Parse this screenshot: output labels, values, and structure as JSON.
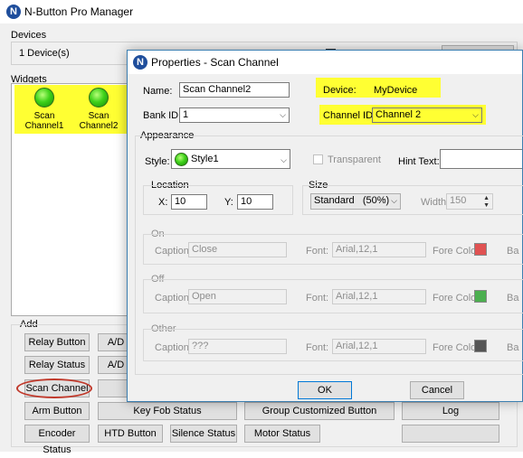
{
  "app": {
    "title": "N-Button Pro Manager",
    "logo_letter": "N"
  },
  "devices": {
    "header": "Devices",
    "count_text": "1 Device(s)"
  },
  "widgets": {
    "header": "Widgets",
    "items": [
      {
        "label": "Scan Channel1"
      },
      {
        "label": "Scan Channel2"
      }
    ]
  },
  "add": {
    "header": "Add",
    "buttons": {
      "relay_button": "Relay Button",
      "relay_status": "Relay Status",
      "scan_channel": "Scan Channel",
      "arm_button": "Arm Button",
      "encoder_status": "Encoder Status",
      "ad1": "A/D",
      "ad2": "A/D",
      "key_fob_status": "Key Fob Status",
      "htd_button": "HTD Button",
      "silence_status": "Silence Status",
      "group_customized_button": "Group Customized Button",
      "motor_status": "Motor Status",
      "log": "Log"
    }
  },
  "dialog": {
    "title": "Properties - Scan Channel",
    "logo_letter": "N",
    "name": {
      "label": "Name:",
      "value": "Scan Channel2"
    },
    "bank_id": {
      "label": "Bank ID:",
      "value": "1"
    },
    "device": {
      "label": "Device:",
      "value": "MyDevice"
    },
    "channel_id": {
      "label": "Channel ID:",
      "value": "Channel 2"
    },
    "appearance": {
      "header": "Appearance",
      "style_label": "Style:",
      "style_value": "Style1",
      "transparent_label": "Transparent",
      "hint_label": "Hint Text:",
      "hint_value": ""
    },
    "location": {
      "header": "Location",
      "x_label": "X:",
      "x_value": "10",
      "y_label": "Y:",
      "y_value": "10"
    },
    "size": {
      "header": "Size",
      "value": "Standard   (50%)",
      "width_label": "Width:",
      "width_value": "150"
    },
    "states": [
      {
        "header": "On",
        "caption_label": "Caption:",
        "caption_value": "Close",
        "font_label": "Font:",
        "font_value": "Arial,12,1",
        "fore_label": "Fore Color:",
        "fore_color": "#e05252",
        "back_label": "Ba"
      },
      {
        "header": "Off",
        "caption_label": "Caption:",
        "caption_value": "Open",
        "font_label": "Font:",
        "font_value": "Arial,12,1",
        "fore_label": "Fore Color:",
        "fore_color": "#4caf50",
        "back_label": "Ba"
      },
      {
        "header": "Other",
        "caption_label": "Caption:",
        "caption_value": "???",
        "font_label": "Font:",
        "font_value": "Arial,12,1",
        "fore_label": "Fore Color:",
        "fore_color": "#555555",
        "back_label": "Ba"
      }
    ],
    "ok_label": "OK",
    "cancel_label": "Cancel"
  },
  "colors": {
    "highlight": "#ffff33",
    "annotation": "#c0392b",
    "dialog_bg": "#f0f0f0"
  }
}
